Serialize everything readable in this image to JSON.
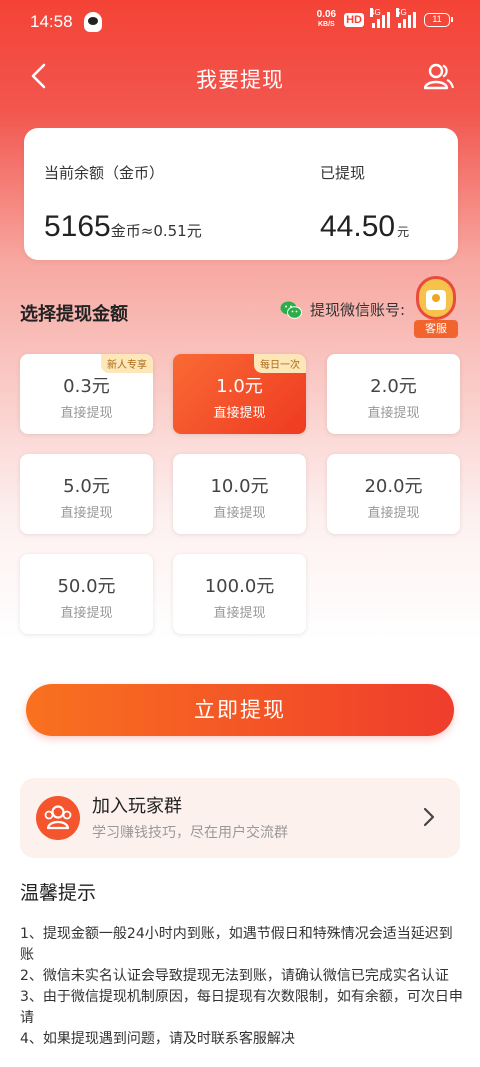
{
  "status_bar": {
    "time": "14:58",
    "net_speed_value": "0.06",
    "net_speed_unit": "KB/S",
    "hd": "HD",
    "signal1": "4G",
    "signal2": "5G",
    "battery": "11"
  },
  "nav": {
    "title": "我要提现"
  },
  "balance": {
    "current_label": "当前余额（金币）",
    "current_value": "5165",
    "current_unit": "金币≈0.51元",
    "withdrawn_label": "已提现",
    "withdrawn_value": "44.50",
    "withdrawn_unit": "元"
  },
  "select": {
    "title": "选择提现金额",
    "wechat_label": "提现微信账号:",
    "service_label": "客服"
  },
  "amounts": [
    {
      "value": "0.3元",
      "sub": "直接提现",
      "badge": "新人专享"
    },
    {
      "value": "1.0元",
      "sub": "直接提现",
      "badge": "每日一次"
    },
    {
      "value": "2.0元",
      "sub": "直接提现"
    },
    {
      "value": "5.0元",
      "sub": "直接提现"
    },
    {
      "value": "10.0元",
      "sub": "直接提现"
    },
    {
      "value": "20.0元",
      "sub": "直接提现"
    },
    {
      "value": "50.0元",
      "sub": "直接提现"
    },
    {
      "value": "100.0元",
      "sub": "直接提现"
    }
  ],
  "withdraw_button": "立即提现",
  "group": {
    "title": "加入玩家群",
    "subtitle": "学习赚钱技巧，尽在用户交流群"
  },
  "tips": {
    "title": "温馨提示",
    "items": [
      "1、提现金额一般24小时内到账，如遇节假日和特殊情况会适当延迟到账",
      "2、微信未实名认证会导致提现无法到账，请确认微信已完成实名认证",
      "3、由于微信提现机制原因，每日提现有次数限制，如有余额，可次日申请",
      "4、如果提现遇到问题，请及时联系客服解决"
    ]
  },
  "colors": {
    "accent": "#ef3d2c",
    "accent_light": "#f9711f",
    "badge_bg": "#fde7b8"
  }
}
